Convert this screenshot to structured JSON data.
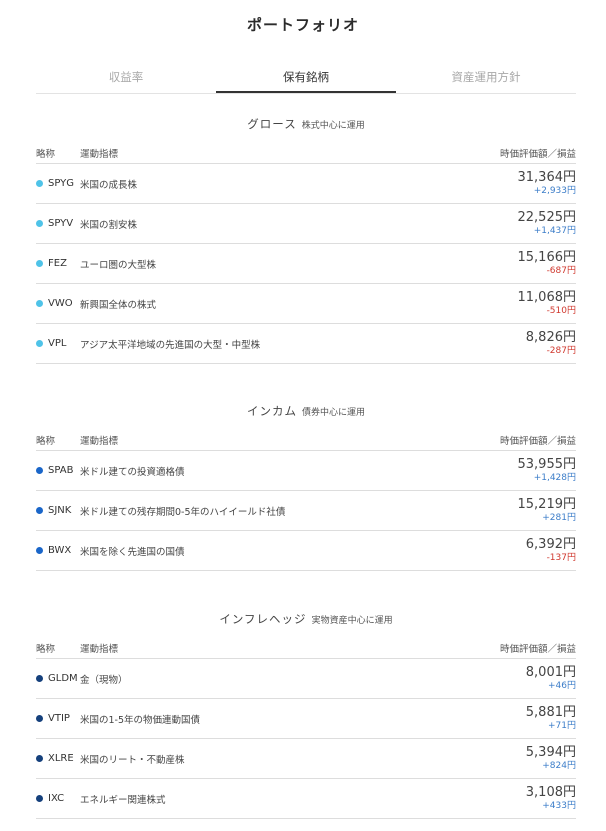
{
  "page_title": "ポートフォリオ",
  "tabs": [
    {
      "label": "収益率",
      "active": false
    },
    {
      "label": "保有銘柄",
      "active": true
    },
    {
      "label": "資産運用方針",
      "active": false
    }
  ],
  "columns": {
    "abbr": "略称",
    "index": "運動指標",
    "value": "時価評価額／損益"
  },
  "colors": {
    "growth": "#4fc3e8",
    "income": "#1a66c9",
    "inflation": "#15407c",
    "positive": "#3d7ec9",
    "negative": "#d0392f"
  },
  "sections": [
    {
      "title": "グロース",
      "subtitle": "株式中心に運用",
      "holdings": [
        {
          "ticker": "SPYG",
          "desc": "米国の成長株",
          "value": "31,364円",
          "pl": "+2,933円",
          "sign": "pos"
        },
        {
          "ticker": "SPYV",
          "desc": "米国の割安株",
          "value": "22,525円",
          "pl": "+1,437円",
          "sign": "pos"
        },
        {
          "ticker": "FEZ",
          "desc": "ユーロ圏の大型株",
          "value": "15,166円",
          "pl": "-687円",
          "sign": "neg"
        },
        {
          "ticker": "VWO",
          "desc": "新興国全体の株式",
          "value": "11,068円",
          "pl": "-510円",
          "sign": "neg"
        },
        {
          "ticker": "VPL",
          "desc": "アジア太平洋地域の先進国の大型・中型株",
          "value": "8,826円",
          "pl": "-287円",
          "sign": "neg"
        }
      ]
    },
    {
      "title": "インカム",
      "subtitle": "債券中心に運用",
      "holdings": [
        {
          "ticker": "SPAB",
          "desc": "米ドル建ての投資適格債",
          "value": "53,955円",
          "pl": "+1,428円",
          "sign": "pos"
        },
        {
          "ticker": "SJNK",
          "desc": "米ドル建ての残存期間0-5年のハイイールド社債",
          "value": "15,219円",
          "pl": "+281円",
          "sign": "pos"
        },
        {
          "ticker": "BWX",
          "desc": "米国を除く先進国の国債",
          "value": "6,392円",
          "pl": "-137円",
          "sign": "neg"
        }
      ]
    },
    {
      "title": "インフレヘッジ",
      "subtitle": "実物資産中心に運用",
      "holdings": [
        {
          "ticker": "GLDM",
          "desc": "金（現物）",
          "value": "8,001円",
          "pl": "+46円",
          "sign": "pos"
        },
        {
          "ticker": "VTIP",
          "desc": "米国の1-5年の物価連動国債",
          "value": "5,881円",
          "pl": "+71円",
          "sign": "pos"
        },
        {
          "ticker": "XLRE",
          "desc": "米国のリート・不動産株",
          "value": "5,394円",
          "pl": "+824円",
          "sign": "pos"
        },
        {
          "ticker": "IXC",
          "desc": "エネルギー関連株式",
          "value": "3,108円",
          "pl": "+433円",
          "sign": "pos"
        }
      ]
    }
  ]
}
